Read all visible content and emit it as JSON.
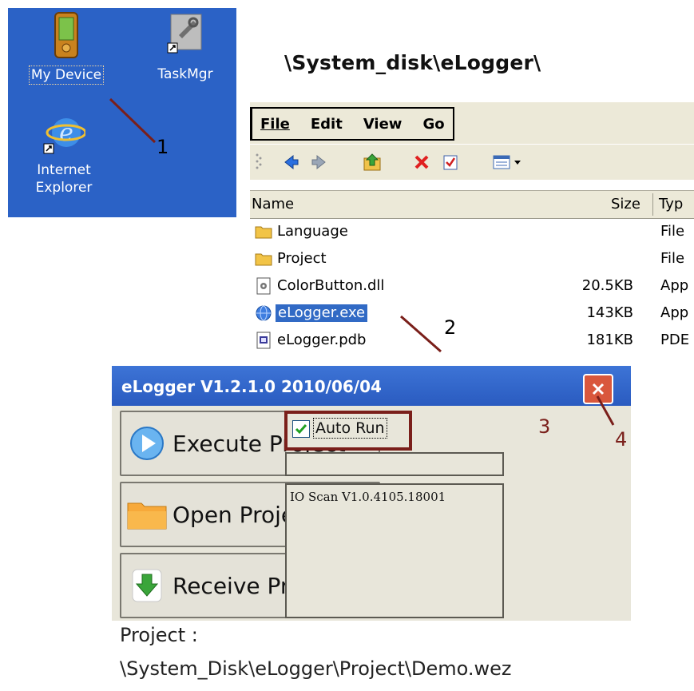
{
  "desktop": {
    "icons": [
      {
        "label": "My Device"
      },
      {
        "label": "TaskMgr"
      },
      {
        "label_line1": "Internet",
        "label_line2": "Explorer"
      }
    ]
  },
  "path_heading": "\\System_disk\\eLogger\\",
  "explorer": {
    "menu": [
      "File",
      "Edit",
      "View",
      "Go"
    ],
    "columns": {
      "name": "Name",
      "size": "Size",
      "type": "Typ"
    },
    "files": [
      {
        "name": "Language",
        "size": "",
        "type": "File",
        "icon": "folder-icon"
      },
      {
        "name": "Project",
        "size": "",
        "type": "File",
        "icon": "folder-icon"
      },
      {
        "name": "ColorButton.dll",
        "size": "20.5KB",
        "type": "App",
        "icon": "dll-file-icon"
      },
      {
        "name": "eLogger.exe",
        "size": "143KB",
        "type": "App",
        "icon": "exe-globe-icon",
        "selected": true
      },
      {
        "name": "eLogger.pdb",
        "size": "181KB",
        "type": "PDE",
        "icon": "pdb-file-icon"
      }
    ]
  },
  "elogger": {
    "title": "eLogger V1.2.1.0 2010/06/04",
    "buttons": {
      "execute": "Execute Project",
      "open": "Open Project",
      "receive": "Receive Project"
    },
    "auto_run_label": "Auto Run",
    "auto_run_checked": true,
    "io_scan": "IO Scan V1.0.4105.18001",
    "project_label": "Project :",
    "project_path": "\\System_Disk\\eLogger\\Project\\Demo.wez"
  },
  "annotations": [
    "1",
    "2",
    "3",
    "4"
  ],
  "colors": {
    "desktop_bg": "#2b62c6",
    "titlebar": "#2a5bc0",
    "selection": "#316ac5",
    "annotation_box": "#7a1f1a",
    "arrow": "#7a1f1a"
  }
}
